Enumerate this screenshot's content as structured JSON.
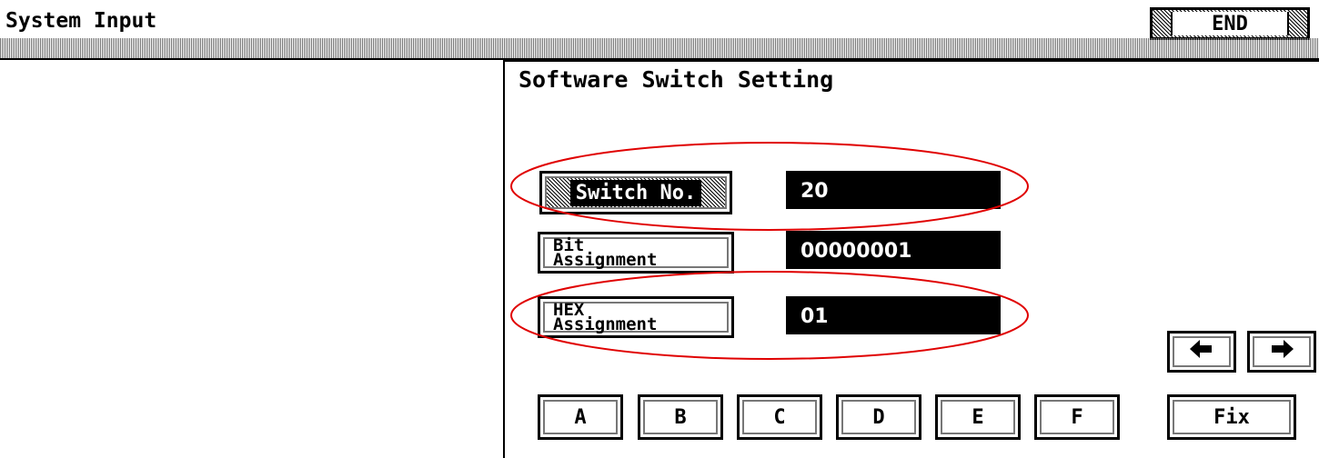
{
  "header": {
    "title": "System Input",
    "end_label": "END"
  },
  "panel": {
    "title": "Software Switch Setting"
  },
  "fields": [
    {
      "label": "Switch No.",
      "value": "20"
    },
    {
      "label_line1": "Bit",
      "label_line2": "Assignment",
      "value": "00000001"
    },
    {
      "label_line1": "HEX",
      "label_line2": "Assignment",
      "value": "01"
    }
  ],
  "hex_keys": [
    "A",
    "B",
    "C",
    "D",
    "E",
    "F"
  ],
  "nav": {
    "left_icon": "arrow-left-icon",
    "right_icon": "arrow-right-icon"
  },
  "fix_label": "Fix",
  "annotation_color": "#e00000"
}
